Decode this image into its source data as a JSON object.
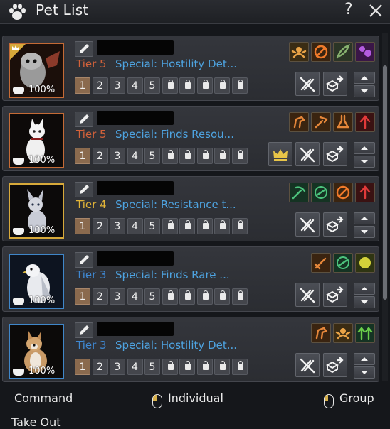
{
  "window": {
    "title": "Pet List",
    "help_icon": "?",
    "close_icon": "close-icon"
  },
  "pets": [
    {
      "tier": "Tier 5",
      "tier_color": "#d4623a",
      "special": "Special: Hostility Det...",
      "hunger": "100%",
      "frame": "orange",
      "has_crown_mark": true,
      "crown_button": false,
      "talents": [
        {
          "name": "hostility-detect-icon",
          "bg": "#3a2c14",
          "fg": "#e9a347"
        },
        {
          "name": "resistance-icon",
          "bg": "#3a2410",
          "fg": "#f07a2a"
        },
        {
          "name": "wing-feather-icon",
          "bg": "#2b3526",
          "fg": "#86b06e"
        },
        {
          "name": "purple-pet-icon",
          "bg": "#3a1647",
          "fg": "#b45ce0"
        }
      ]
    },
    {
      "tier": "Tier 5",
      "tier_color": "#d4623a",
      "special": "Special: Finds Resou...",
      "hunger": "100%",
      "frame": "orange",
      "has_crown_mark": false,
      "crown_button": true,
      "talents": [
        {
          "name": "horse-icon",
          "bg": "#3a2410",
          "fg": "#e6873a"
        },
        {
          "name": "hammer-icon",
          "bg": "#3a2410",
          "fg": "#e6873a"
        },
        {
          "name": "alchemy-flask-icon",
          "bg": "#3a2410",
          "fg": "#e6873a"
        },
        {
          "name": "red-arrow-icon",
          "bg": "#3a1212",
          "fg": "#e23a3a"
        }
      ]
    },
    {
      "tier": "Tier 4",
      "tier_color": "#e2b438",
      "special": "Special: Resistance t...",
      "hunger": "100%",
      "frame": "gold",
      "has_crown_mark": false,
      "crown_button": false,
      "talents": [
        {
          "name": "pickaxe-icon",
          "bg": "#153323",
          "fg": "#4cc27c"
        },
        {
          "name": "green-dash-icon",
          "bg": "#153323",
          "fg": "#4cc27c"
        },
        {
          "name": "resistance-icon",
          "bg": "#3a2410",
          "fg": "#f07a2a"
        },
        {
          "name": "red-arrow-icon",
          "bg": "#3a1212",
          "fg": "#e23a3a"
        }
      ]
    },
    {
      "tier": "Tier 3",
      "tier_color": "#3f88d2",
      "special": "Special: Finds Rare ...",
      "hunger": "100%",
      "frame": "blue",
      "has_crown_mark": false,
      "crown_button": false,
      "talents": [
        {
          "name": "sword-icon",
          "bg": "#3a2410",
          "fg": "#e6873a"
        },
        {
          "name": "green-dash-icon",
          "bg": "#153323",
          "fg": "#4cc27c"
        },
        {
          "name": "gold-coin-icon",
          "bg": "#2f3512",
          "fg": "#d4d23a"
        }
      ]
    },
    {
      "tier": "Tier 3",
      "tier_color": "#3f88d2",
      "special": "Special: Hostility Det...",
      "hunger": "100%",
      "frame": "blue",
      "has_crown_mark": false,
      "crown_button": false,
      "talents": [
        {
          "name": "horse-icon",
          "bg": "#3a2410",
          "fg": "#e6873a"
        },
        {
          "name": "hostility-detect-icon",
          "bg": "#3a2c14",
          "fg": "#e9a347"
        },
        {
          "name": "green-arrow-icon",
          "bg": "#153323",
          "fg": "#6bd04a"
        }
      ]
    }
  ],
  "skill_slots": [
    "1",
    "2",
    "3",
    "4",
    "5"
  ],
  "locked_slot_count": 5,
  "actions": {
    "disable_icon": "disable-skill-icon",
    "exchange_icon": "exchange-box-icon",
    "up_icon": "arrow-up-icon",
    "down_icon": "arrow-down-icon",
    "crown_icon": "crown-icon"
  },
  "footer": {
    "command": "Command",
    "individual": "Individual",
    "group": "Group",
    "take_out": "Take Out"
  }
}
